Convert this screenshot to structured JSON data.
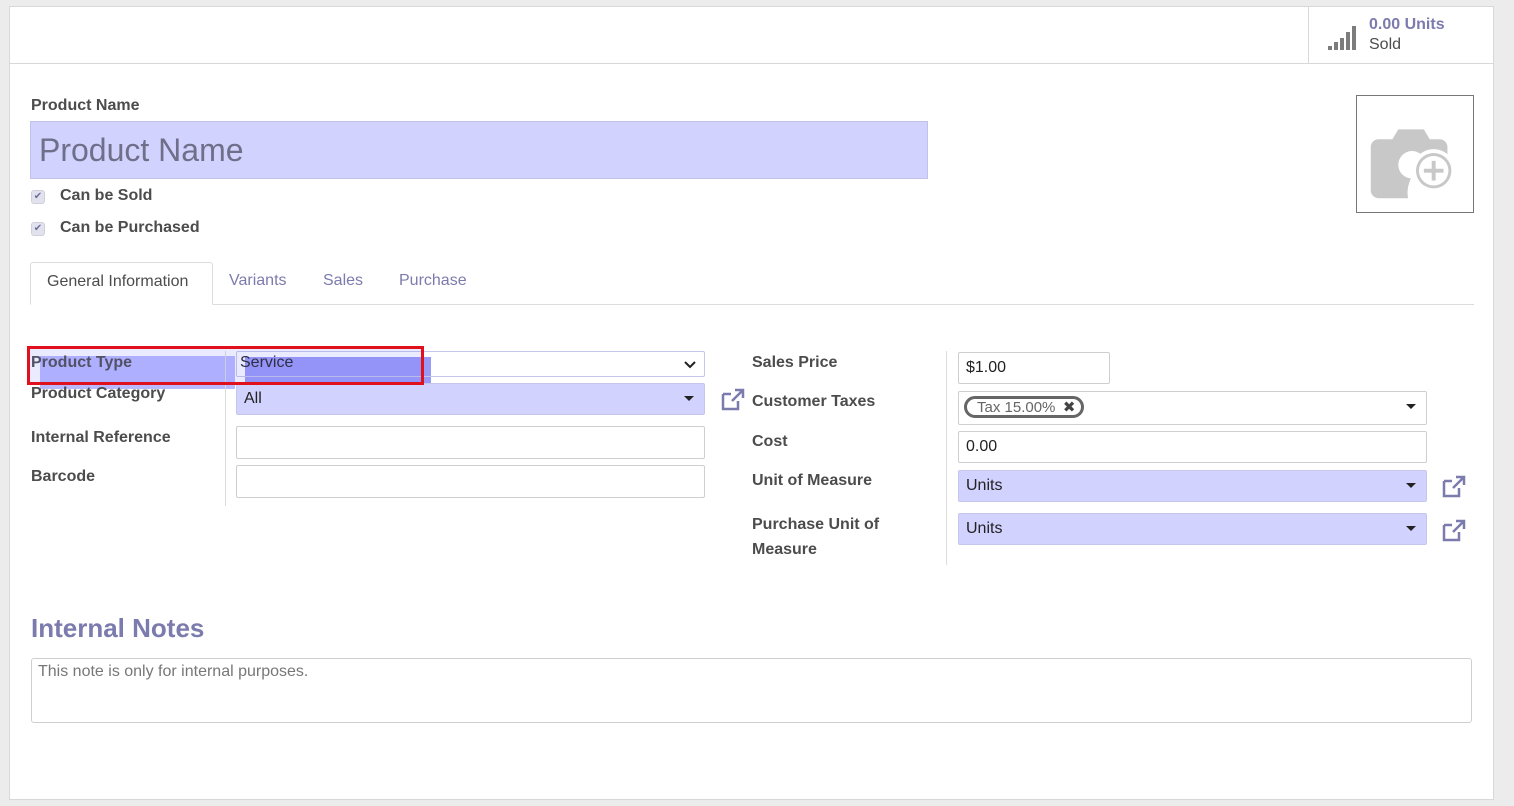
{
  "stat_button": {
    "value": "0.00 Units",
    "label": "Sold",
    "icon": "signal-bars-icon"
  },
  "product_name": {
    "label": "Product Name",
    "placeholder": "Product Name",
    "value": ""
  },
  "checkboxes": [
    {
      "label": "Can be Sold",
      "checked": true
    },
    {
      "label": "Can be Purchased",
      "checked": true
    }
  ],
  "image_placeholder_icon": "camera-add-icon",
  "tabs": [
    {
      "label": "General Information",
      "active": true
    },
    {
      "label": "Variants",
      "active": false
    },
    {
      "label": "Sales",
      "active": false
    },
    {
      "label": "Purchase",
      "active": false
    }
  ],
  "left_fields": {
    "product_type": {
      "label": "Product Type",
      "value": "Service"
    },
    "product_category": {
      "label": "Product Category",
      "value": "All"
    },
    "internal_reference": {
      "label": "Internal Reference",
      "value": ""
    },
    "barcode": {
      "label": "Barcode",
      "value": ""
    }
  },
  "right_fields": {
    "sales_price": {
      "label": "Sales Price",
      "value": "$1.00"
    },
    "customer_taxes": {
      "label": "Customer Taxes",
      "tag": "Tax 15.00%"
    },
    "cost": {
      "label": "Cost",
      "value": "0.00"
    },
    "unit_of_measure": {
      "label": "Unit of Measure",
      "value": "Units"
    },
    "purchase_uom": {
      "label_line1": "Purchase Unit of",
      "label_line2": "Measure",
      "value": "Units"
    }
  },
  "internal_notes": {
    "title": "Internal Notes",
    "placeholder": "This note is only for internal purposes."
  },
  "colors": {
    "accent": "#7c7bad",
    "required_bg": "#d2d2ff",
    "highlight": "#e0101c"
  }
}
